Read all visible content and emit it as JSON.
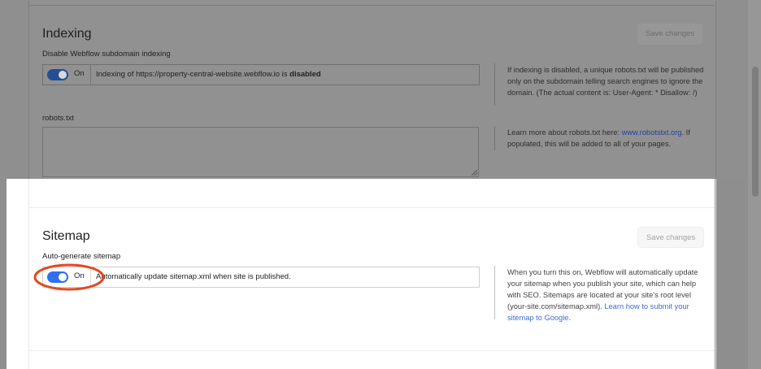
{
  "indexing": {
    "title": "Indexing",
    "save_label": "Save changes",
    "field_label": "Disable Webflow subdomain indexing",
    "toggle_state": "On",
    "row_text_prefix": "Indexing of https://property-central-website.webflow.io is",
    "row_text_status": "disabled",
    "help_text": "If indexing is disabled, a unique robots.txt will be published only on the subdomain telling search engines to ignore the domain. (The actual content is: User-Agent: * Disallow: /)",
    "robots_label": "robots.txt",
    "robots_value": "",
    "robots_help_prefix": "Learn more about robots.txt here:",
    "robots_help_link": "www.robotstxt.org",
    "robots_help_suffix": ". If populated, this will be added to all of your pages."
  },
  "sitemap": {
    "title": "Sitemap",
    "save_label": "Save changes",
    "field_label": "Auto-generate sitemap",
    "toggle_state": "On",
    "row_text": "Automatically update sitemap.xml when site is published.",
    "help_text_prefix": "When you turn this on, Webflow will automatically update your sitemap when you publish your site, which can help with SEO. Sitemaps are located at your site's root level (your-site.com/sitemap.xml).",
    "help_link": "Learn how to submit your sitemap to Google",
    "help_text_suffix": "."
  },
  "colors": {
    "toggle_on": "#2f6ff0",
    "link": "#3f6ad9",
    "annotation": "#e5481f",
    "dim_overlay": "#8f8f8f"
  },
  "icons": {
    "toggle": "toggle-switch-icon",
    "resize": "resize-handle-icon",
    "annotation": "highlight-circle-icon"
  }
}
